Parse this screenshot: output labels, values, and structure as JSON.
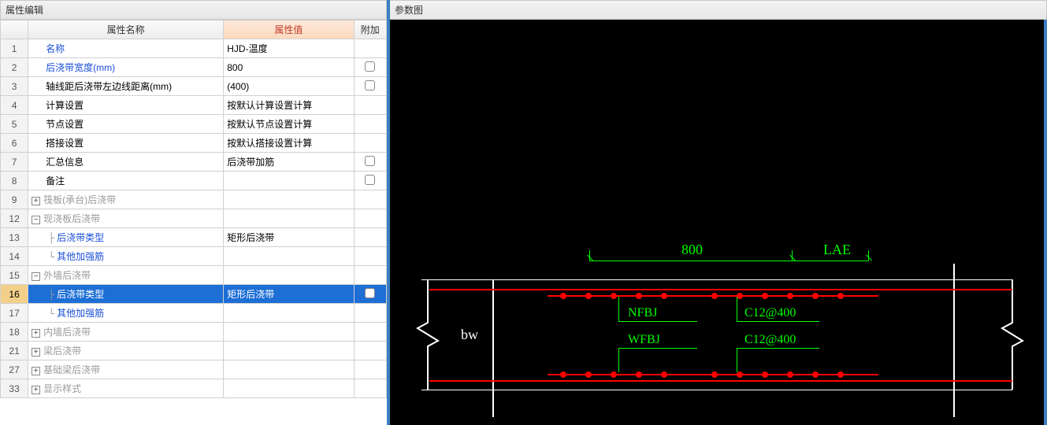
{
  "left": {
    "title": "属性编辑",
    "headers": {
      "name": "属性名称",
      "value": "属性值",
      "extra": "附加"
    },
    "rows": [
      {
        "num": "1",
        "name": "名称",
        "value": "HJD-温度",
        "link": true,
        "check": false
      },
      {
        "num": "2",
        "name": "后浇带宽度(mm)",
        "value": "800",
        "link": true,
        "check": true
      },
      {
        "num": "3",
        "name": "轴线距后浇带左边线距离(mm)",
        "value": "(400)",
        "check": true
      },
      {
        "num": "4",
        "name": "计算设置",
        "value": "按默认计算设置计算"
      },
      {
        "num": "5",
        "name": "节点设置",
        "value": "按默认节点设置计算"
      },
      {
        "num": "6",
        "name": "搭接设置",
        "value": "按默认搭接设置计算"
      },
      {
        "num": "7",
        "name": "汇总信息",
        "value": "后浇带加筋",
        "check": true
      },
      {
        "num": "8",
        "name": "备注",
        "value": "",
        "check": true
      },
      {
        "num": "9",
        "name": "筏板(承台)后浇带",
        "group": true,
        "collapsed": true,
        "muted": true
      },
      {
        "num": "12",
        "name": "现浇板后浇带",
        "group": true,
        "collapsed": false,
        "muted": true
      },
      {
        "num": "13",
        "name": "后浇带类型",
        "value": "矩形后浇带",
        "child": true,
        "link": true
      },
      {
        "num": "14",
        "name": "其他加强筋",
        "child": true,
        "last": true,
        "link": true
      },
      {
        "num": "15",
        "name": "外墙后浇带",
        "group": true,
        "collapsed": false,
        "muted": true
      },
      {
        "num": "16",
        "name": "后浇带类型",
        "value": "矩形后浇带",
        "child": true,
        "link": true,
        "selected": true,
        "check": true
      },
      {
        "num": "17",
        "name": "其他加强筋",
        "child": true,
        "last": true,
        "link": true
      },
      {
        "num": "18",
        "name": "内墙后浇带",
        "group": true,
        "collapsed": true,
        "muted": true
      },
      {
        "num": "21",
        "name": "梁后浇带",
        "group": true,
        "collapsed": true,
        "muted": true
      },
      {
        "num": "27",
        "name": "基础梁后浇带",
        "group": true,
        "collapsed": true,
        "muted": true
      },
      {
        "num": "33",
        "name": "显示样式",
        "group": true,
        "collapsed": true,
        "muted": true
      }
    ]
  },
  "right": {
    "title": "参数图",
    "dim_800": "800",
    "dim_lae": "LAE",
    "bw": "bw",
    "nfbj": "NFBJ",
    "wfbj": "WFBJ",
    "c12_1": "C12@400",
    "c12_2": "C12@400"
  }
}
